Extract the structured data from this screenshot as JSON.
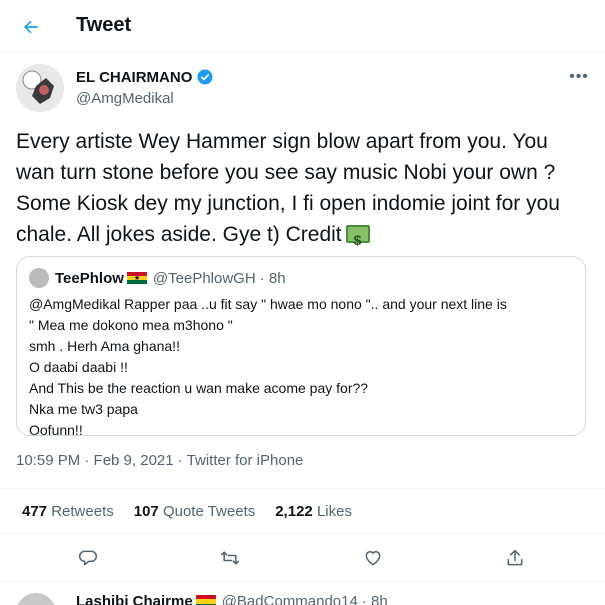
{
  "header": {
    "title": "Tweet"
  },
  "tweet": {
    "author_name": "EL CHAIRMANO",
    "author_handle": "@AmgMedikal",
    "text": "Every artiste Wey Hammer sign blow apart from you. You wan turn stone before you see say music Nobi your own ? Some Kiosk dey my junction, I fi open indomie joint for you chale. All jokes aside. Gye t) Credit",
    "timestamp": "10:59 PM · Feb 9, 2021 · Twitter for iPhone",
    "stats": {
      "retweets_count": "477",
      "retweets_label": "Retweets",
      "quotes_count": "107",
      "quotes_label": "Quote Tweets",
      "likes_count": "2,122",
      "likes_label": "Likes"
    }
  },
  "quote": {
    "name": "TeePhlow",
    "handle": "@TeePhlowGH",
    "time": "· 8h",
    "lines": [
      "@AmgMedikal Rapper paa ..u fit say \" hwae mo nono \".. and your next line is",
      "\" Mea me dokono mea m3hono \"",
      "smh . Herh Ama ghana!!",
      "O daabi daabi !!",
      "And This be the reaction u wan make acome pay for??",
      "Nka me tw3 papa",
      "Oofunn!!"
    ]
  },
  "next_reply": {
    "name": "Lashibi Chairme",
    "handle": "@BadCommando14",
    "time": "· 8h"
  },
  "colors": {
    "accent": "#1d9bf0",
    "text_primary": "#0f1419",
    "text_secondary": "#536471",
    "border": "#cfd9de"
  },
  "icons": {
    "back": "arrow-left-icon",
    "verified": "verified-badge-icon",
    "more": "more-horizontal-icon",
    "reply": "reply-icon",
    "retweet": "retweet-icon",
    "like": "heart-icon",
    "share": "share-icon"
  }
}
